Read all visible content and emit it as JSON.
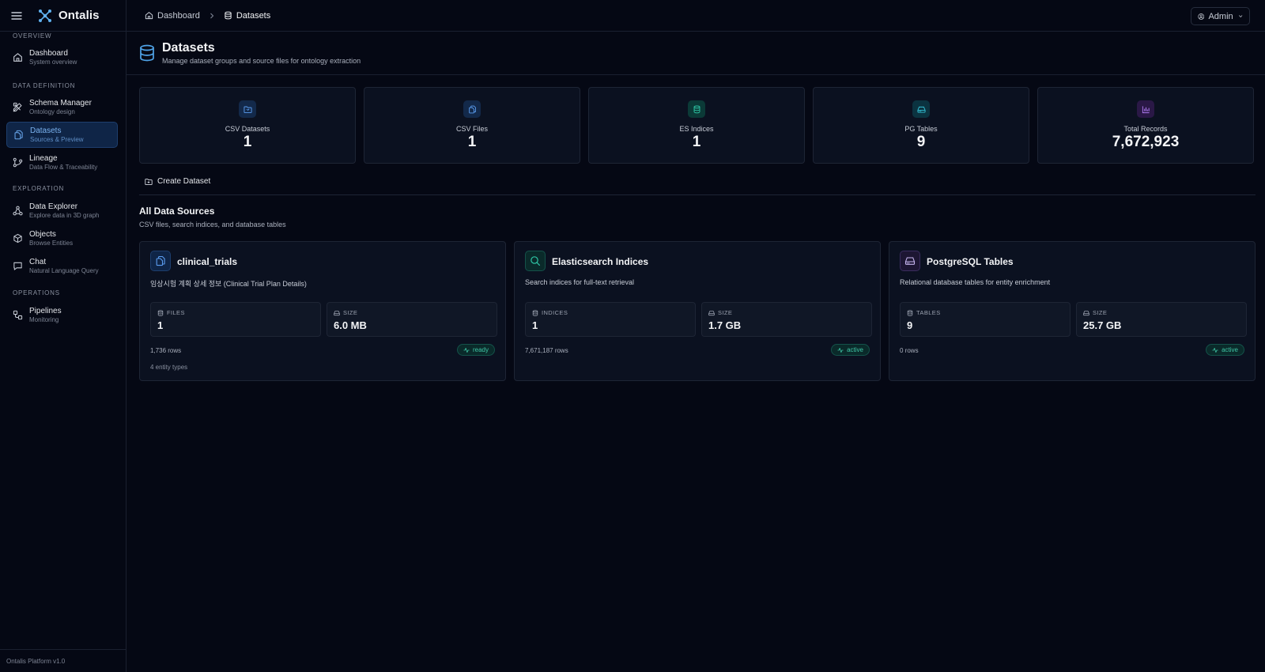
{
  "app": {
    "name": "Ontalis",
    "version": "Ontalis Platform v1.0"
  },
  "breadcrumb": [
    {
      "label": "Dashboard",
      "icon": "home-icon"
    },
    {
      "label": "Datasets",
      "icon": "database-icon"
    }
  ],
  "user": {
    "label": "Admin"
  },
  "sidebar": {
    "sections": [
      {
        "label": "Overview"
      },
      {
        "label": "Data Definition"
      },
      {
        "label": "Exploration"
      },
      {
        "label": "Operations"
      }
    ],
    "items": [
      {
        "title": "Dashboard",
        "subtitle": "System overview",
        "icon": "home-icon"
      },
      {
        "title": "Schema Manager",
        "subtitle": "Ontology design",
        "icon": "schema-icon"
      },
      {
        "title": "Datasets",
        "subtitle": "Sources & Preview",
        "icon": "files-icon",
        "active": true
      },
      {
        "title": "Lineage",
        "subtitle": "Data Flow & Traceability",
        "icon": "lineage-icon"
      },
      {
        "title": "Data Explorer",
        "subtitle": "Explore data in 3D graph",
        "icon": "network-icon"
      },
      {
        "title": "Objects",
        "subtitle": "Browse Entities",
        "icon": "cube-icon"
      },
      {
        "title": "Chat",
        "subtitle": "Natural Language Query",
        "icon": "chat-icon"
      },
      {
        "title": "Pipelines",
        "subtitle": "Monitoring",
        "icon": "workflow-icon"
      }
    ]
  },
  "page": {
    "title": "Datasets",
    "subtitle": "Manage dataset groups and source files for ontology extraction"
  },
  "stats": [
    {
      "label": "CSV Datasets",
      "value": "1",
      "icon": "folder-icon",
      "color": "#3b82f6"
    },
    {
      "label": "CSV Files",
      "value": "1",
      "icon": "files-icon",
      "color": "#3b82f6"
    },
    {
      "label": "ES Indices",
      "value": "1",
      "icon": "database-icon",
      "color": "#14b8a6"
    },
    {
      "label": "PG Tables",
      "value": "9",
      "icon": "harddrive-icon",
      "color": "#06b6d4"
    },
    {
      "label": "Total Records",
      "value": "7,672,923",
      "icon": "bar-chart-icon",
      "color": "#a855f7"
    }
  ],
  "toolbar": {
    "create_label": "Create Dataset"
  },
  "sources": {
    "title": "All Data Sources",
    "subtitle": "CSV files, search indices, and database tables",
    "cards": [
      {
        "title": "clinical_trials",
        "description": "임상시험 계획 상세 정보 (Clinical Trial Plan Details)",
        "icon": "files-icon",
        "metrics": [
          {
            "label": "Files",
            "value": "1",
            "icon": "database-icon"
          },
          {
            "label": "Size",
            "value": "6.0 MB",
            "icon": "harddrive-icon"
          }
        ],
        "rows": "1,736 rows",
        "extra": "4 entity types",
        "status": "ready"
      },
      {
        "title": "Elasticsearch Indices",
        "description": "Search indices for full-text retrieval",
        "icon": "search-icon",
        "metrics": [
          {
            "label": "Indices",
            "value": "1",
            "icon": "database-icon"
          },
          {
            "label": "Size",
            "value": "1.7 GB",
            "icon": "harddrive-icon"
          }
        ],
        "rows": "7,671,187 rows",
        "status": "active"
      },
      {
        "title": "PostgreSQL Tables",
        "description": "Relational database tables for entity enrichment",
        "icon": "harddrive-icon",
        "metrics": [
          {
            "label": "Tables",
            "value": "9",
            "icon": "database-icon"
          },
          {
            "label": "Size",
            "value": "25.7 GB",
            "icon": "harddrive-icon"
          }
        ],
        "rows": "0 rows",
        "status": "active"
      }
    ]
  }
}
